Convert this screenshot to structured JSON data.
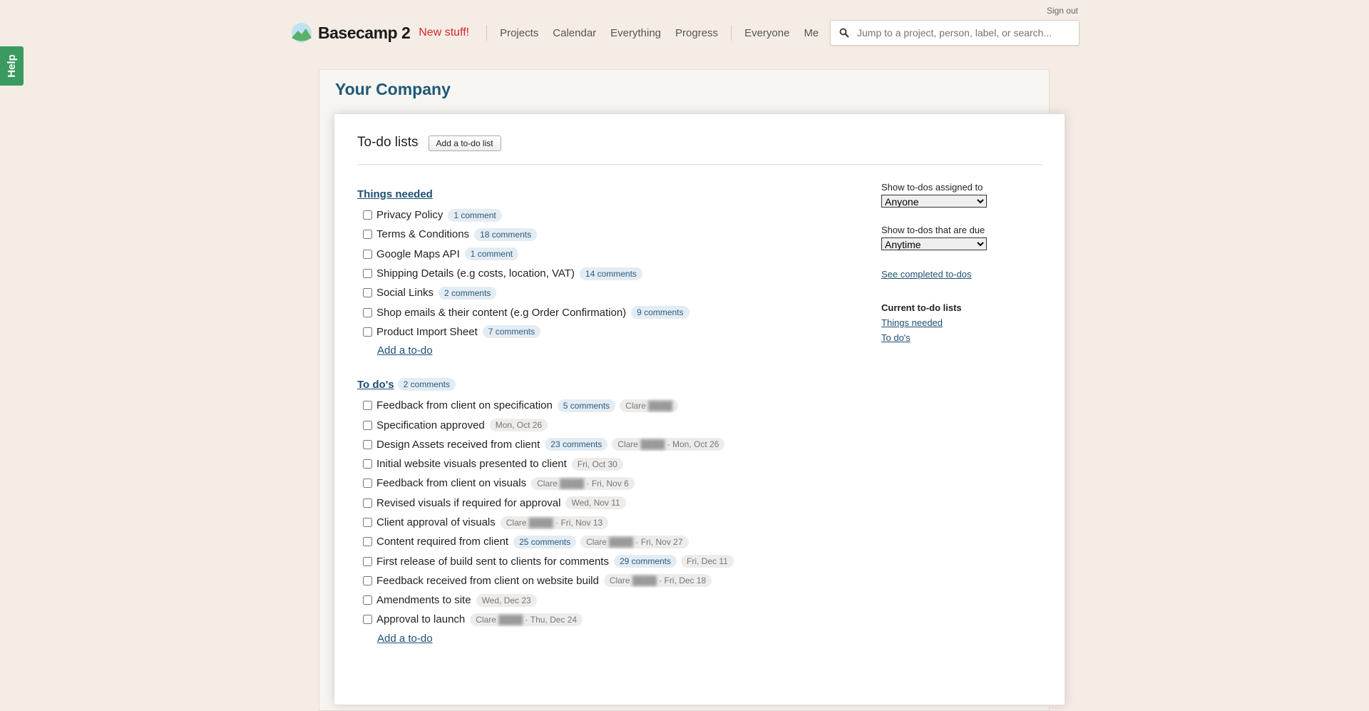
{
  "help_label": "Help",
  "sign_out": "Sign out",
  "brand": {
    "name": "Basecamp 2",
    "new_stuff": "New stuff!"
  },
  "nav": {
    "main": [
      "Projects",
      "Calendar",
      "Everything",
      "Progress"
    ],
    "people": [
      "Everyone",
      "Me"
    ]
  },
  "search": {
    "placeholder": "Jump to a project, person, label, or search..."
  },
  "company_title": "Your Company",
  "card": {
    "title": "To-do lists",
    "add_list_label": "Add a to-do list"
  },
  "lists": [
    {
      "title": "Things needed",
      "comments": "",
      "todos": [
        {
          "text": "Privacy Policy",
          "comments": "1 comment",
          "assignee": "",
          "due": ""
        },
        {
          "text": "Terms & Conditions",
          "comments": "18 comments",
          "assignee": "",
          "due": ""
        },
        {
          "text": "Google Maps API",
          "comments": "1 comment",
          "assignee": "",
          "due": ""
        },
        {
          "text": "Shipping Details (e.g costs, location, VAT)",
          "comments": "14 comments",
          "assignee": "",
          "due": ""
        },
        {
          "text": "Social Links",
          "comments": "2 comments",
          "assignee": "",
          "due": ""
        },
        {
          "text": "Shop emails & their content (e.g Order Confirmation)",
          "comments": "9 comments",
          "assignee": "",
          "due": ""
        },
        {
          "text": "Product Import Sheet",
          "comments": "7 comments",
          "assignee": "",
          "due": ""
        }
      ],
      "add_label": "Add a to-do"
    },
    {
      "title": "To do's",
      "comments": "2 comments",
      "todos": [
        {
          "text": "Feedback from client on specification",
          "comments": "5 comments",
          "assignee": "Clare",
          "due": ""
        },
        {
          "text": "Specification approved",
          "comments": "",
          "assignee": "",
          "due": "Mon, Oct 26"
        },
        {
          "text": "Design Assets received from client",
          "comments": "23 comments",
          "assignee": "Clare",
          "due": "Mon, Oct 26"
        },
        {
          "text": "Initial website visuals presented to client",
          "comments": "",
          "assignee": "",
          "due": "Fri, Oct 30"
        },
        {
          "text": "Feedback from client on visuals",
          "comments": "",
          "assignee": "Clare",
          "due": "Fri, Nov 6"
        },
        {
          "text": "Revised visuals if required for approval",
          "comments": "",
          "assignee": "",
          "due": "Wed, Nov 11"
        },
        {
          "text": "Client approval of visuals",
          "comments": "",
          "assignee": "Clare",
          "due": "Fri, Nov 13"
        },
        {
          "text": "Content required from client",
          "comments": "25 comments",
          "assignee": "Clare",
          "due": "Fri, Nov 27"
        },
        {
          "text": "First release of build sent to clients for comments",
          "comments": "29 comments",
          "assignee": "",
          "due": "Fri, Dec 11"
        },
        {
          "text": "Feedback received from client on website build",
          "comments": "",
          "assignee": "Clare",
          "due": "Fri, Dec 18"
        },
        {
          "text": "Amendments to site",
          "comments": "",
          "assignee": "",
          "due": "Wed, Dec 23"
        },
        {
          "text": "Approval to launch",
          "comments": "",
          "assignee": "Clare",
          "due": "Thu, Dec 24"
        }
      ],
      "add_label": "Add a to-do"
    }
  ],
  "sidebar": {
    "assigned_label": "Show to-dos assigned to",
    "assigned_value": "Anyone",
    "due_label": "Show to-dos that are due",
    "due_value": "Anytime",
    "completed_link": "See completed to-dos",
    "current_heading": "Current to-do lists",
    "current_lists": [
      "Things needed",
      "To do's"
    ]
  },
  "colors": {
    "background": "#f5ede5",
    "brand_red": "#d3262b",
    "link": "#1d4f72",
    "company_title": "#1f5876",
    "help_green": "#3a9a5f"
  }
}
